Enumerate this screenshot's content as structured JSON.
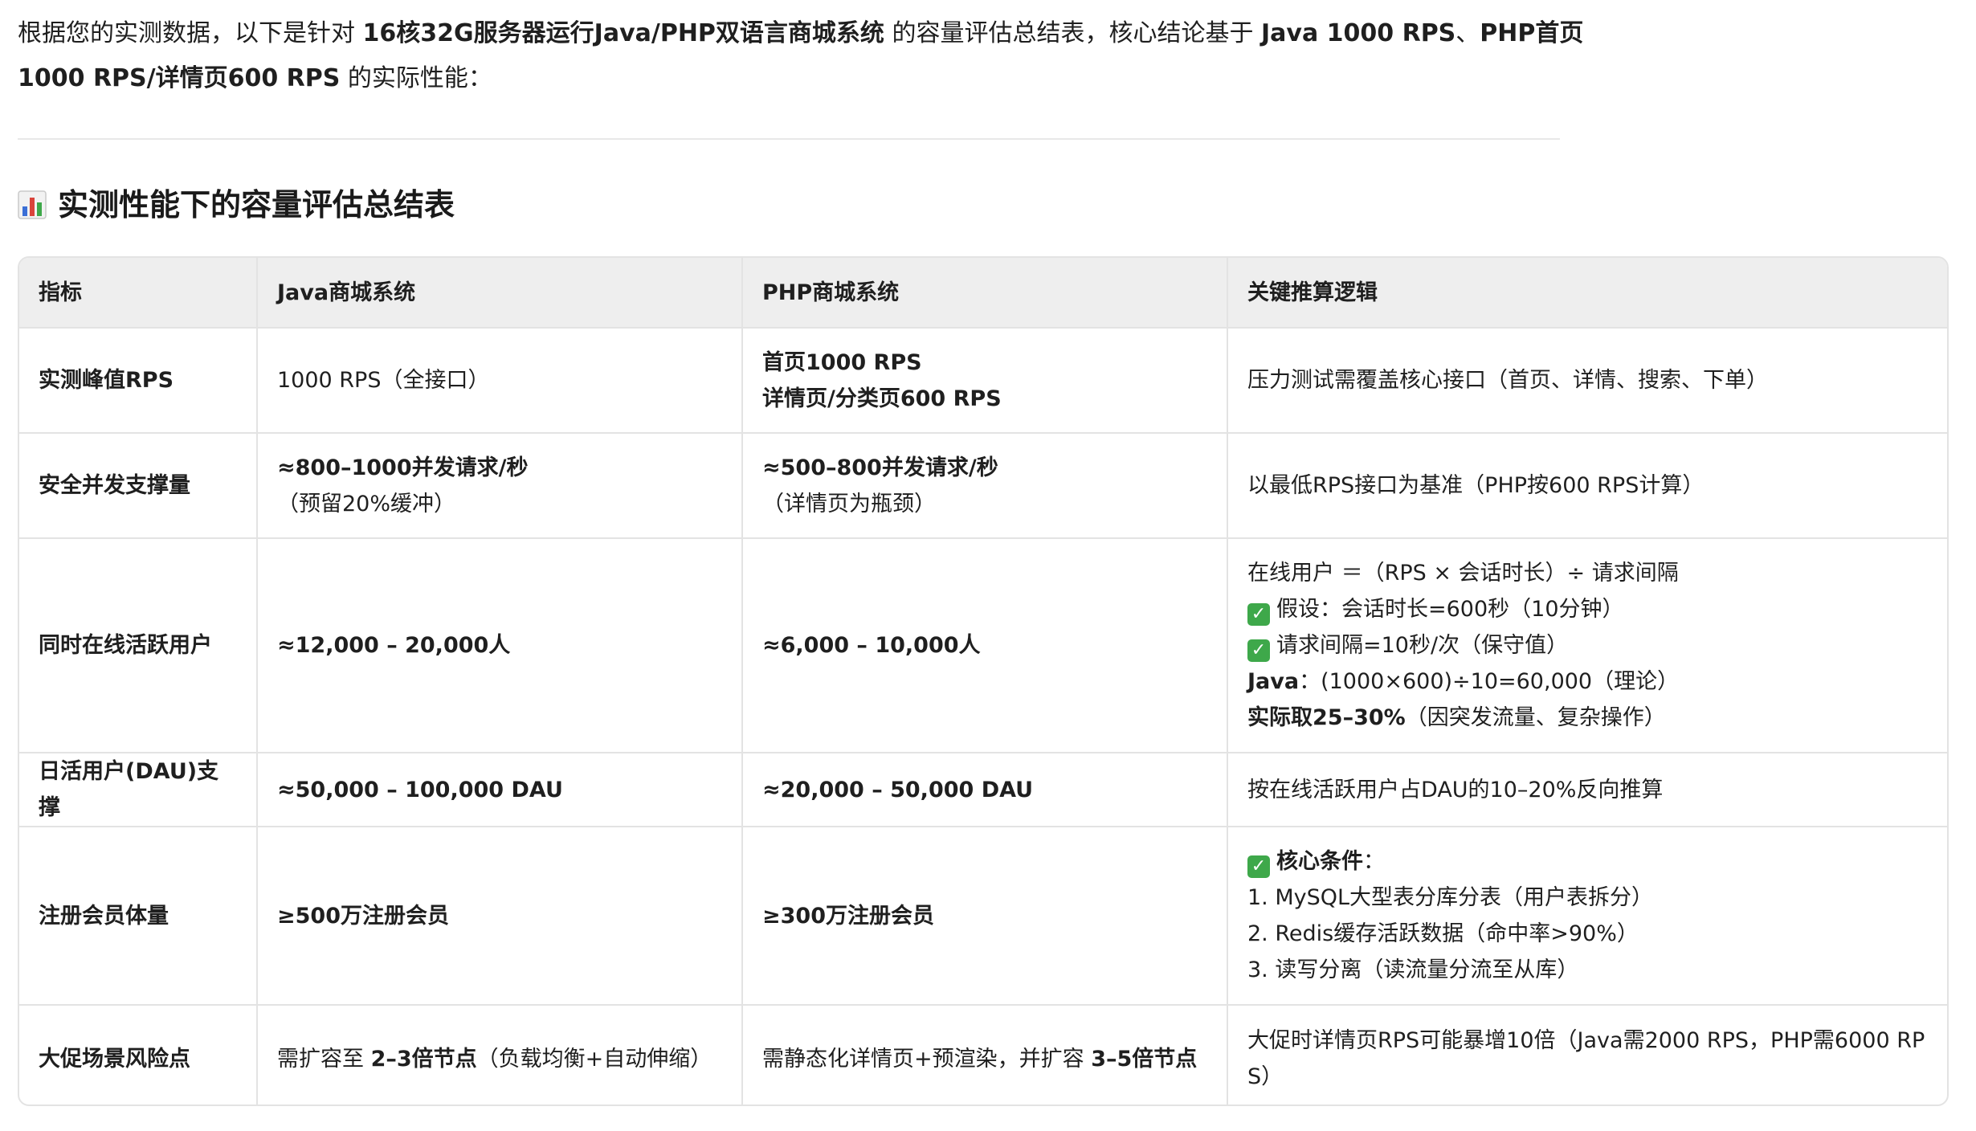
{
  "intro": {
    "text_a": "根据您的实测数据，以下是针对 ",
    "bold_a": "16核32G服务器运行Java/PHP双语言商城系统",
    "text_b": " 的容量评估总结表，核心结论基于 ",
    "bold_b": "Java 1000 RPS",
    "text_c": "、",
    "bold_c": "PHP首页1000 RPS/详情页600 RPS",
    "text_d": " 的实际性能："
  },
  "section": {
    "icon": "bar-chart-icon",
    "title": "实测性能下的容量评估总结表"
  },
  "table": {
    "headers": [
      "指标",
      "Java商城系统",
      "PHP商城系统",
      "关键推算逻辑"
    ],
    "rows": [
      {
        "metric": "实测峰值RPS",
        "java": "1000 RPS（全接口）",
        "php_line1": "首页1000 RPS",
        "php_line2": "详情页/分类页600 RPS",
        "logic": "压力测试需覆盖核心接口（首页、详情、搜索、下单）"
      },
      {
        "metric": "安全并发支撑量",
        "java_bold": "≈800–1000并发请求/秒",
        "java_note": "（预留20%缓冲）",
        "php_bold": "≈500–800并发请求/秒",
        "php_note": "（详情页为瓶颈）",
        "logic": "以最低RPS接口为基准（PHP按600 RPS计算）"
      },
      {
        "metric": "同时在线活跃用户",
        "java": "≈12,000 – 20,000人",
        "php": "≈6,000 – 10,000人",
        "logic_formula": "在线用户 ＝（RPS × 会话时长）÷ 请求间隔",
        "logic_check1": "假设：会话时长=600秒（10分钟）",
        "logic_check2": "请求间隔=10秒/次（保守值）",
        "logic_java_label": "Java",
        "logic_java_calc": "：(1000×600)÷10=60,000（理论）",
        "logic_actual_bold": "实际取25–30%",
        "logic_actual_note": "（因突发流量、复杂操作）"
      },
      {
        "metric": "日活用户(DAU)支撑",
        "java": "≈50,000 – 100,000 DAU",
        "php": "≈20,000 – 50,000 DAU",
        "logic": "按在线活跃用户占DAU的10–20%反向推算"
      },
      {
        "metric": "注册会员体量",
        "java": "≥500万注册会员",
        "php": "≥300万注册会员",
        "logic_title": "核心条件",
        "logic_title_colon": "：",
        "logic_item1": "1. MySQL大型表分库分表（用户表拆分）",
        "logic_item2": "2. Redis缓存活跃数据（命中率>90%）",
        "logic_item3": "3. 读写分离（读流量分流至从库）"
      },
      {
        "metric": "大促场景风险点",
        "java_pre": "需扩容至 ",
        "java_bold": "2–3倍节点",
        "java_post": "（负载均衡+自动伸缩）",
        "php_pre": "需静态化详情页+预渲染，并扩容 ",
        "php_bold": "3–5倍节点",
        "logic": "大促时详情页RPS可能暴增10倍（Java需2000 RPS，PHP需6000 RPS）"
      }
    ]
  },
  "colors": {
    "header_bg": "#eeeeee",
    "border": "#e3e3e3",
    "check_green": "#3ea84a"
  }
}
